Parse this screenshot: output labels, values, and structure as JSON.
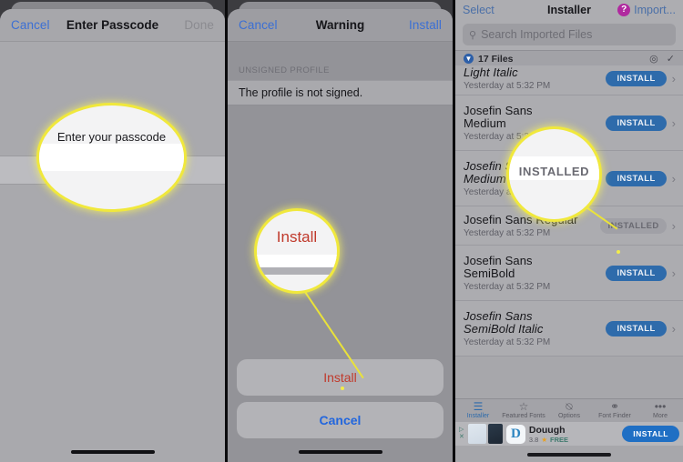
{
  "panels": {
    "left": {
      "nav": {
        "cancel_label": "Cancel",
        "title": "Enter Passcode",
        "done_label": "Done"
      },
      "callout_text": "Enter your passcode"
    },
    "middle": {
      "nav": {
        "cancel_label": "Cancel",
        "title": "Warning",
        "install_label": "Install"
      },
      "section_label": "UNSIGNED PROFILE",
      "row_text": "The profile is not signed.",
      "action_sheet": {
        "install_label": "Install",
        "cancel_label": "Cancel"
      },
      "callout_text": "Install"
    },
    "right": {
      "nav": {
        "select_label": "Select",
        "title": "Installer",
        "help_glyph": "?",
        "import_label": "Import..."
      },
      "search": {
        "icon": "search-icon",
        "placeholder": "Search Imported Files"
      },
      "files_header": {
        "badge_glyph": "▼",
        "count_label": "17 Files",
        "eye_icon": "◎",
        "check_icon": "✓"
      },
      "files": [
        {
          "name": "Light Italic",
          "italic": true,
          "date": "Yesterday at 5:32 PM",
          "action": "INSTALL",
          "installed": false
        },
        {
          "name": "Josefin Sans Medium",
          "italic": false,
          "date": "Yesterday at 5:32 PM",
          "action": "INSTALL",
          "installed": false
        },
        {
          "name": "Josefin Sans Medium Italic",
          "italic": true,
          "date": "Yesterday at 5:32 PM",
          "action": "INSTALL",
          "installed": false
        },
        {
          "name": "Josefin Sans Regular",
          "italic": false,
          "date": "Yesterday at 5:32 PM",
          "action": "INSTALLED",
          "installed": true
        },
        {
          "name": "Josefin Sans SemiBold",
          "italic": false,
          "date": "Yesterday at 5:32 PM",
          "action": "INSTALL",
          "installed": false
        },
        {
          "name": "Josefin Sans SemiBold Italic",
          "italic": true,
          "date": "Yesterday at 5:32 PM",
          "action": "INSTALL",
          "installed": false
        }
      ],
      "tabs": [
        {
          "label": "Installer",
          "icon": "☰",
          "active": true
        },
        {
          "label": "Featured Fonts",
          "icon": "☆",
          "active": false
        },
        {
          "label": "Options",
          "icon": "▷",
          "active": false
        },
        {
          "label": "Font Finder",
          "icon": "⌕",
          "active": false
        },
        {
          "label": "More",
          "icon": "•••",
          "active": false
        }
      ],
      "ad": {
        "mark_top": "▷",
        "mark_bottom": "✕",
        "icon_letter": "D",
        "title": "Douugh",
        "rating": "3.8",
        "star": "★",
        "price": "FREE",
        "install_label": "INSTALL"
      },
      "callout_text": "INSTALLED"
    }
  },
  "colors": {
    "accent_blue": "#2e6bab",
    "link_blue": "#3b6fd4",
    "destructive_red": "#c0392b",
    "callout_yellow": "#f0e83c",
    "help_magenta": "#b0299f",
    "sheet_gray": "#a9a9ad"
  }
}
